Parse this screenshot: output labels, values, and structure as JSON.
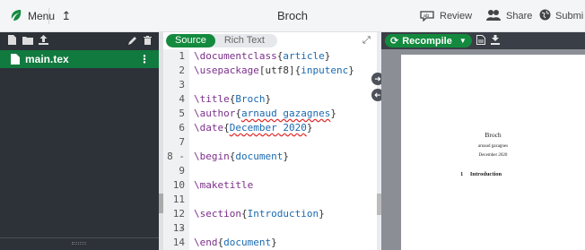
{
  "toolbar": {
    "menu_label": "Menu",
    "title": "Broch",
    "review_label": "Review",
    "share_label": "Share",
    "submit_label": "Submi"
  },
  "files": {
    "items": [
      {
        "name": "main.tex",
        "dots": "⋮"
      }
    ]
  },
  "editor": {
    "source_tab": "Source",
    "rich_tab": "Rich Text",
    "lines": [
      {
        "n": "1",
        "cmd": "\\documentclass",
        "open": "{",
        "arg": "article",
        "close": "}"
      },
      {
        "n": "2",
        "cmd": "\\usepackage",
        "opt": "[utf8]",
        "open": "{",
        "arg": "inputenc",
        "close": "}"
      },
      {
        "n": "3"
      },
      {
        "n": "4",
        "cmd": "\\title",
        "open": "{",
        "arg": "Broch",
        "close": "}"
      },
      {
        "n": "5",
        "cmd": "\\author",
        "open": "{",
        "arg": "arnaud gazagnes",
        "close": "}"
      },
      {
        "n": "6",
        "cmd": "\\date",
        "open": "{",
        "arg": "December 2020",
        "close": "}"
      },
      {
        "n": "7"
      },
      {
        "n": "8 -",
        "cmd": "\\begin",
        "open": "{",
        "arg": "document",
        "close": "}"
      },
      {
        "n": "9"
      },
      {
        "n": "10",
        "cmd": "\\maketitle"
      },
      {
        "n": "11"
      },
      {
        "n": "12 -",
        "cmd": "\\section",
        "open": "{",
        "arg": "Introduction",
        "close": "}"
      },
      {
        "n": "13"
      },
      {
        "n": "14",
        "cmd": "\\end",
        "open": "{",
        "arg": "document",
        "close": "}"
      }
    ]
  },
  "pdf": {
    "recompile_label": "Recompile",
    "title": "Broch",
    "author": "arnaud gazagnes",
    "date": "December 2020",
    "section_num": "1",
    "section_title": "Introduction"
  },
  "colors": {
    "accent": "#138a3e",
    "filepanel_bg": "#2d3138"
  }
}
